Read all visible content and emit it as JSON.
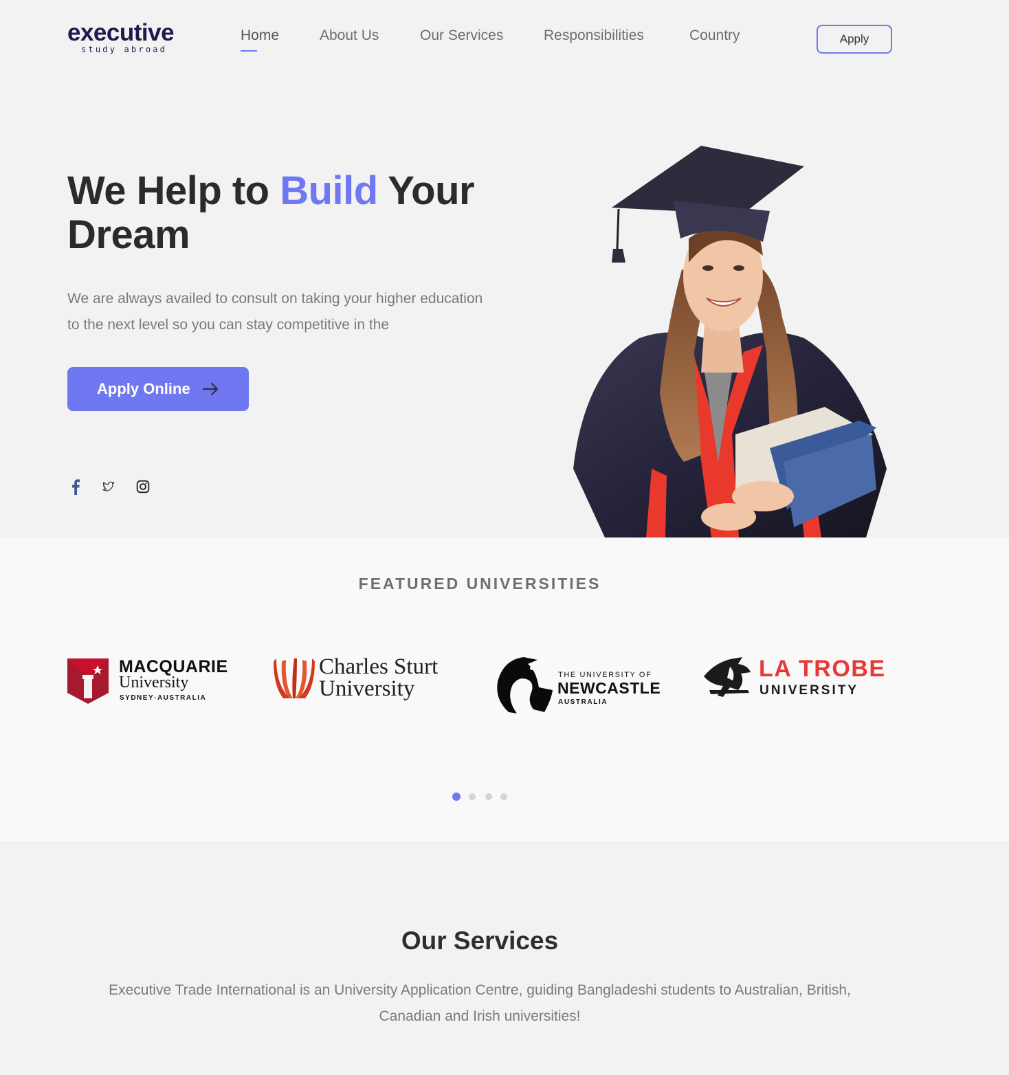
{
  "brand": {
    "name": "executive",
    "tagline": "study abroad"
  },
  "nav": {
    "items": [
      {
        "label": "Home",
        "active": true
      },
      {
        "label": "About Us",
        "active": false
      },
      {
        "label": "Our Services",
        "active": false
      },
      {
        "label": "Responsibilities",
        "active": false
      },
      {
        "label": "Country",
        "active": false
      }
    ],
    "apply_label": "Apply"
  },
  "hero": {
    "title_part1": "We Help to ",
    "title_accent": "Build",
    "title_part2": " Your Dream",
    "description": "We are always availed to consult on taking your higher education to the next level so you can stay competitive in the",
    "cta_label": "Apply Online",
    "socials": [
      "facebook-icon",
      "twitter-icon",
      "instagram-icon"
    ]
  },
  "featured": {
    "title": "FEATURED UNIVERSITIES",
    "universities": [
      {
        "line1": "MACQUARIE",
        "line2": "University",
        "line3": "SYDNEY·AUSTRALIA"
      },
      {
        "line1": "Charles Sturt",
        "line2": "University"
      },
      {
        "line1": "THE UNIVERSITY OF",
        "line2": "NEWCASTLE",
        "line3": "AUSTRALIA"
      },
      {
        "line1": "LA TROBE",
        "line2": "UNIVERSITY"
      }
    ],
    "carousel_pages": 4,
    "carousel_active": 1
  },
  "services": {
    "title": "Our Services",
    "description": "Executive Trade International is an University Application Centre, guiding Bangladeshi students to Australian, British, Canadian and Irish universities!"
  },
  "colors": {
    "accent": "#6f78f0",
    "brand_navy": "#1d1b4c",
    "macquarie_red": "#a6192e",
    "csu_red": "#d03a1c",
    "latrobe_red": "#e53935"
  }
}
